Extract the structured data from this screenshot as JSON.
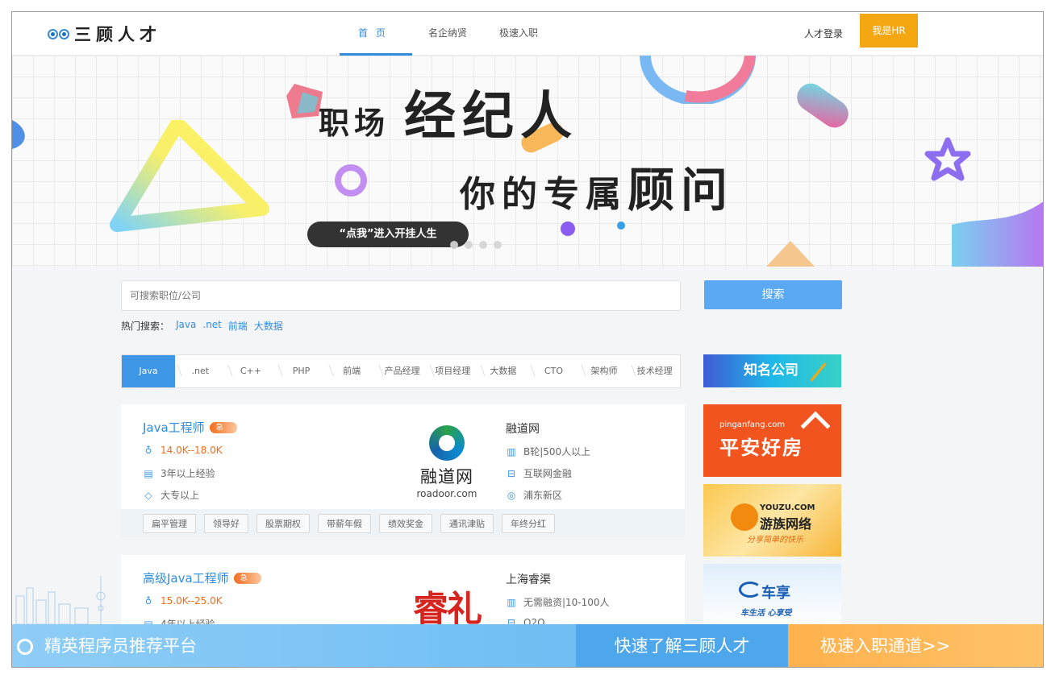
{
  "header": {
    "logo_text": "三顾人才",
    "nav": [
      {
        "label": "首页"
      },
      {
        "label": "名企纳贤"
      },
      {
        "label": "极速入职"
      }
    ],
    "login_label": "人才登录",
    "hr_label": "我是HR"
  },
  "banner": {
    "title_small": "职场",
    "title_big": "经纪人",
    "subtitle_small": "你的专属",
    "subtitle_big": "顾问",
    "cta_label": "“点我”进入开挂人生",
    "slides": 4,
    "active_slide": 1
  },
  "search": {
    "placeholder": "可搜索职位/公司",
    "button_label": "搜索",
    "hot_label": "热门搜索：",
    "hot_keywords": [
      "Java",
      ".net",
      "前端",
      "大数据"
    ]
  },
  "categories": [
    "Java",
    ".net",
    "C++",
    "PHP",
    "前端",
    "产品经理",
    "项目经理",
    "大数据",
    "CTO",
    "架构师",
    "技术经理"
  ],
  "jobs": [
    {
      "title": "Java工程师",
      "urgent_label": "急",
      "salary": "14.0K--18.0K",
      "experience": "3年以上经验",
      "education": "大专以上",
      "company": {
        "logo_name": "融道网",
        "logo_url": "roadoor.com",
        "name": "融道网",
        "stage": "B轮|500人以上",
        "industry": "互联网金融",
        "location": "浦东新区"
      },
      "tags": [
        "扁平管理",
        "领导好",
        "股票期权",
        "带薪年假",
        "绩效奖金",
        "通讯津贴",
        "年终分红"
      ]
    },
    {
      "title": "高级Java工程师",
      "urgent_label": "急",
      "salary": "15.0K--25.0K",
      "experience": "4年以上经验",
      "company": {
        "logo_text": "睿礼",
        "name": "上海睿渠",
        "stage": "无需融资|10-100人",
        "industry": "O2O"
      }
    }
  ],
  "sidebar": {
    "famous_label": "知名公司",
    "ads": [
      {
        "small": "pinganfang.com",
        "big": "平安好房"
      },
      {
        "en": "YOUZU.COM",
        "cn": "游族网络",
        "slogan": "分享简单的快乐"
      },
      {
        "cn": "车享",
        "slogan": "车生活 心享受"
      }
    ]
  },
  "bottom_bar": {
    "tagline": "精英程序员推荐平台",
    "learn_label": "快速了解三顾人才",
    "fast_label": "极速入职通道>>"
  },
  "colors": {
    "accent": "#2f8ddf",
    "hr_button": "#f5a712",
    "salary": "#f26d1c",
    "search_button": "#5aa9f2"
  }
}
